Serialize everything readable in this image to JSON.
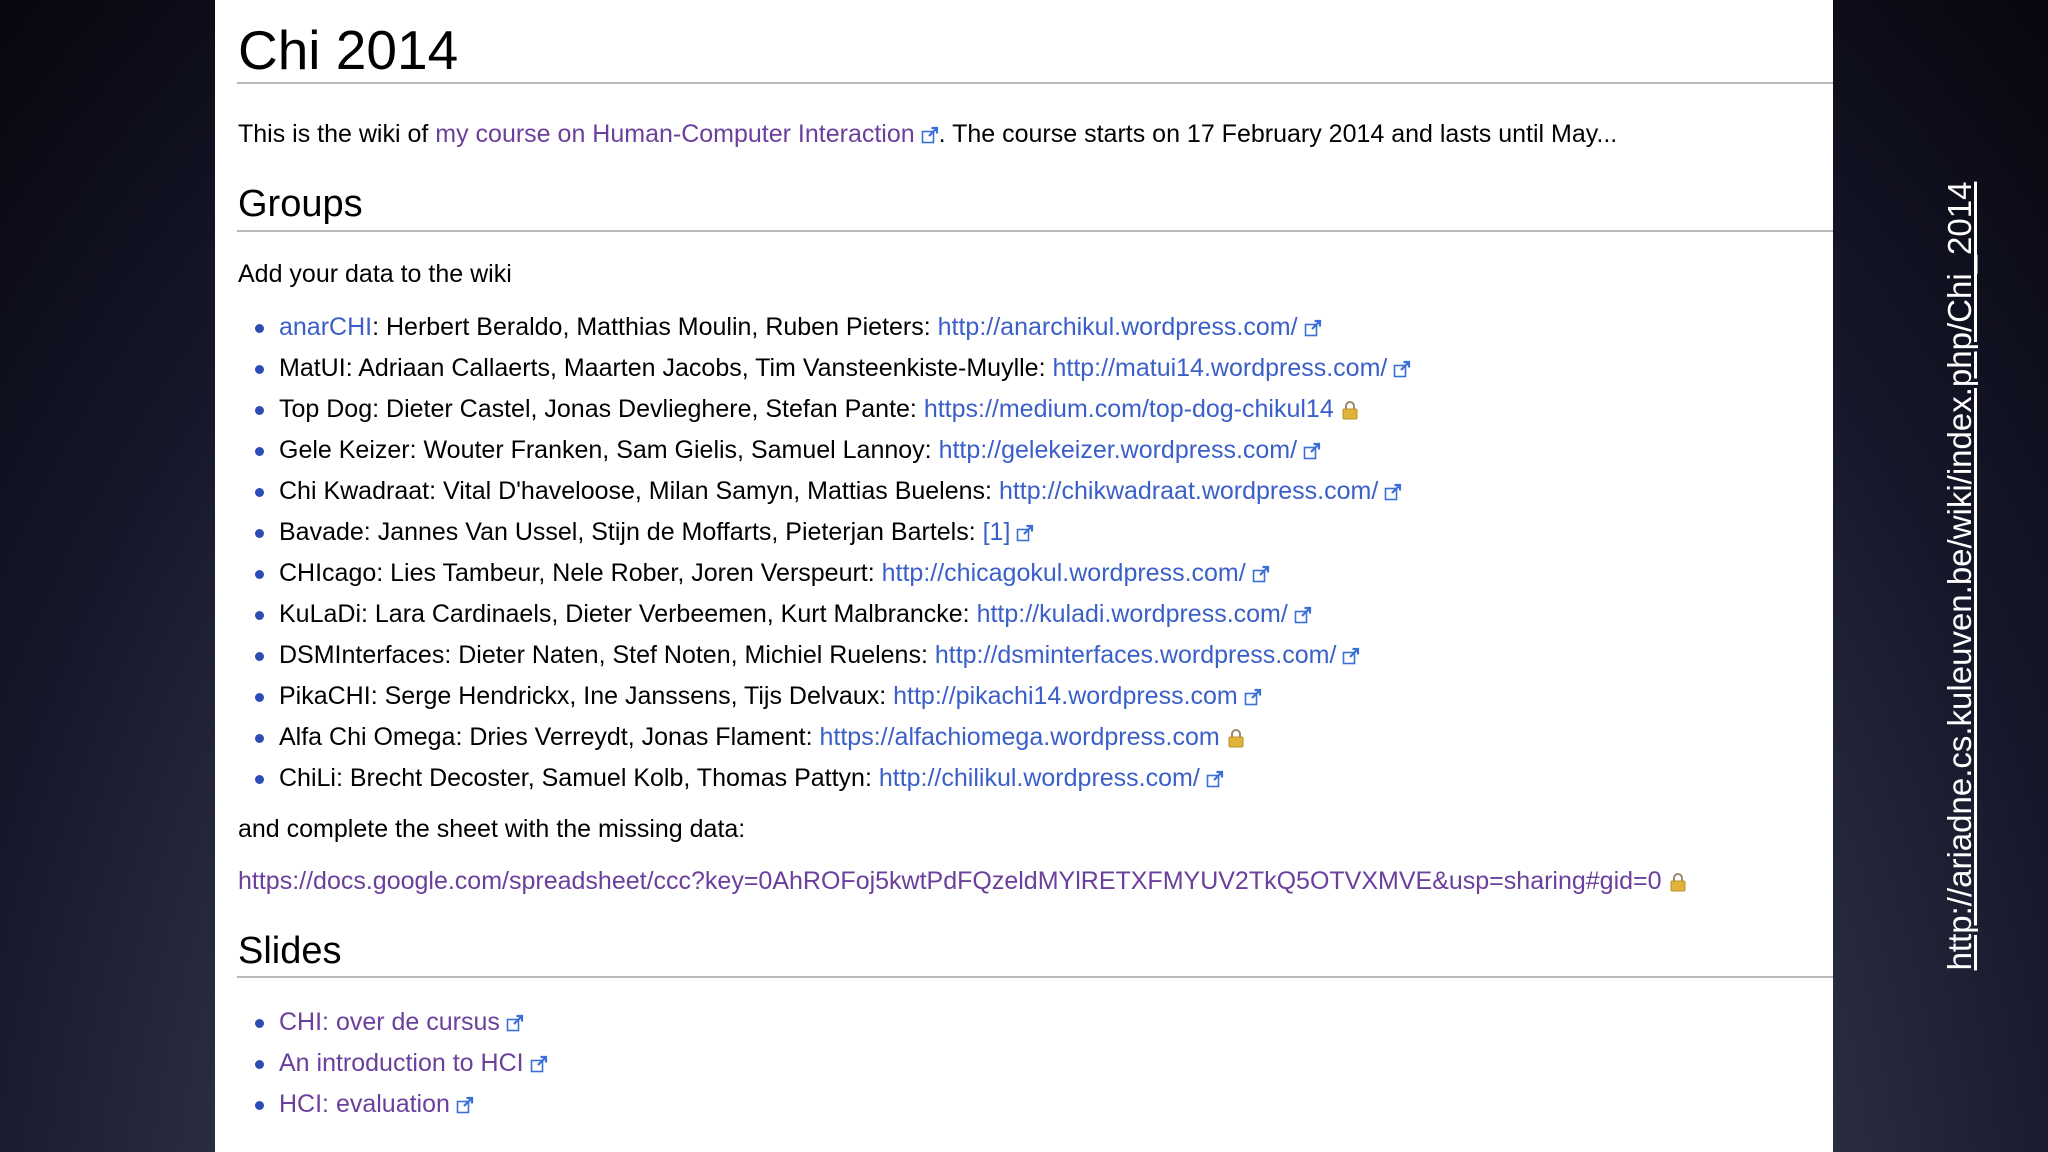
{
  "page": {
    "title": "Chi 2014",
    "intro": {
      "prefix": "This is the wiki of ",
      "link_text": "my course on Human-Computer Interaction",
      "suffix": ". The course starts on 17 February 2014 and lasts until May..."
    }
  },
  "groups": {
    "heading": "Groups",
    "lead_text": "Add your data to the wiki",
    "items": [
      {
        "label": "anarCHI",
        "label_is_link": true,
        "members": ": Herbert Beraldo, Matthias Moulin, Ruben Pieters: ",
        "link_text": "http://anarchikul.wordpress.com/",
        "icon": "external-link-icon"
      },
      {
        "label": "MatUI",
        "label_is_link": false,
        "members": ": Adriaan Callaerts, Maarten Jacobs, Tim Vansteenkiste-Muylle: ",
        "link_text": "http://matui14.wordpress.com/",
        "icon": "external-link-icon"
      },
      {
        "label": "Top Dog",
        "label_is_link": false,
        "members": ": Dieter Castel, Jonas Devlieghere, Stefan Pante: ",
        "link_text": "https://medium.com/top-dog-chikul14",
        "icon": "lock-icon"
      },
      {
        "label": "Gele Keizer",
        "label_is_link": false,
        "members": ": Wouter Franken, Sam Gielis, Samuel Lannoy: ",
        "link_text": "http://gelekeizer.wordpress.com/",
        "icon": "external-link-icon"
      },
      {
        "label": "Chi Kwadraat",
        "label_is_link": false,
        "members": ": Vital D'haveloose, Milan Samyn, Mattias Buelens: ",
        "link_text": "http://chikwadraat.wordpress.com/",
        "icon": "external-link-icon"
      },
      {
        "label": "Bavade",
        "label_is_link": false,
        "members": ": Jannes Van Ussel, Stijn de Moffarts, Pieterjan Bartels: ",
        "link_text": "[1]",
        "icon": "external-link-icon"
      },
      {
        "label": "CHIcago",
        "label_is_link": false,
        "members": ": Lies Tambeur, Nele Rober, Joren Verspeurt: ",
        "link_text": "http://chicagokul.wordpress.com/",
        "icon": "external-link-icon"
      },
      {
        "label": "KuLaDi",
        "label_is_link": false,
        "members": ": Lara Cardinaels, Dieter Verbeemen, Kurt Malbrancke: ",
        "link_text": "http://kuladi.wordpress.com/",
        "icon": "external-link-icon"
      },
      {
        "label": "DSMInterfaces",
        "label_is_link": false,
        "members": ": Dieter Naten, Stef Noten, Michiel Ruelens: ",
        "link_text": "http://dsminterfaces.wordpress.com/",
        "icon": "external-link-icon"
      },
      {
        "label": "PikaCHI",
        "label_is_link": false,
        "members": ": Serge Hendrickx, Ine Janssens, Tijs Delvaux: ",
        "link_text": "http://pikachi14.wordpress.com",
        "icon": "external-link-icon"
      },
      {
        "label": "Alfa Chi Omega",
        "label_is_link": false,
        "members": ": Dries Verreydt, Jonas Flament: ",
        "link_text": "https://alfachiomega.wordpress.com",
        "icon": "lock-icon"
      },
      {
        "label": "ChiLi",
        "label_is_link": false,
        "members": ": Brecht Decoster, Samuel Kolb, Thomas Pattyn: ",
        "link_text": "http://chilikul.wordpress.com/",
        "icon": "external-link-icon"
      }
    ],
    "sheet_text": "and complete the sheet with the missing data:",
    "sheet_link": "https://docs.google.com/spreadsheet/ccc?key=0AhROFoj5kwtPdFQzeldMYlRETXFMYUV2TkQ5OTVXMVE&usp=sharing#gid=0"
  },
  "slides": {
    "heading": "Slides",
    "items": [
      {
        "label": "CHI: over de cursus",
        "icon": "external-link-icon"
      },
      {
        "label": "An introduction to HCI",
        "icon": "external-link-icon"
      },
      {
        "label": "HCI: evaluation",
        "icon": "external-link-icon"
      }
    ]
  },
  "side_url": "http://ariadne.cs.kuleuven.be/wiki/index.php/Chi_2014",
  "colors": {
    "link": "#3a5fc8",
    "visited_link": "#6b3f9c",
    "bullet": "#2b4bb5",
    "lock": "#e0b43a",
    "rule": "#b8b8b8"
  }
}
